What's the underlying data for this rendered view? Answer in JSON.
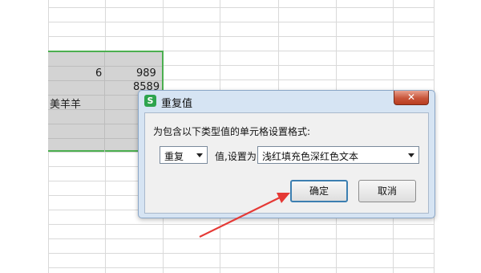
{
  "spreadsheet": {
    "cells": {
      "r1c1": "6",
      "r1c2": "989",
      "r2c2": "8589",
      "r3c1": "美羊羊"
    }
  },
  "dialog": {
    "app_icon_glyph": "S",
    "title": "重复值",
    "close_glyph": "✕",
    "prompt": "为包含以下类型值的单元格设置格式:",
    "condition_select": "重复",
    "mid_label": "值,设置为",
    "format_select": "浅红填充色深红色文本",
    "ok_label": "确定",
    "cancel_label": "取消"
  },
  "annotation": {
    "color": "#e53935"
  }
}
